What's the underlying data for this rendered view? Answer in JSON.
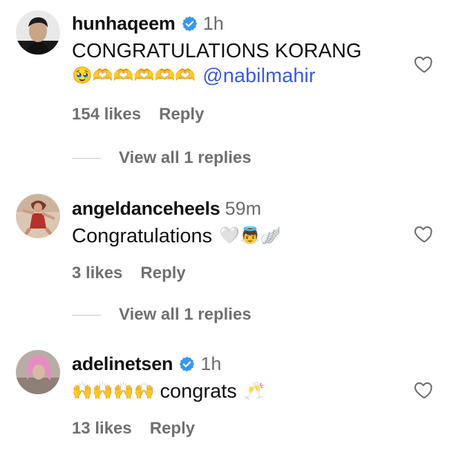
{
  "comments": [
    {
      "username": "hunhaqeem",
      "verified": true,
      "time": "1h",
      "text_line1": "CONGRATULATIONS KORANG",
      "text_line2_emojis": "🥹🫶🫶🫶🫶🫶",
      "mention": "@nabilmahir",
      "likes": "154 likes",
      "reply_label": "Reply",
      "view_replies": "View all 1 replies"
    },
    {
      "username": "angeldanceheels",
      "verified": false,
      "time": "59m",
      "text": "Congratulations",
      "emojis": "🤍👼🪽",
      "likes": "3 likes",
      "reply_label": "Reply",
      "view_replies": "View all 1 replies"
    },
    {
      "username": "adelinetsen",
      "verified": true,
      "time": "1h",
      "emojis_before": "🙌🙌🙌🙌",
      "text": "congrats",
      "emojis_after": "🥂",
      "likes": "13 likes",
      "reply_label": "Reply"
    }
  ],
  "icons": {
    "verified": "verified-badge-icon",
    "like": "heart-icon"
  },
  "colors": {
    "verified": "#3897f0",
    "mention": "#3d5bd9",
    "muted": "#6f6f6f"
  }
}
